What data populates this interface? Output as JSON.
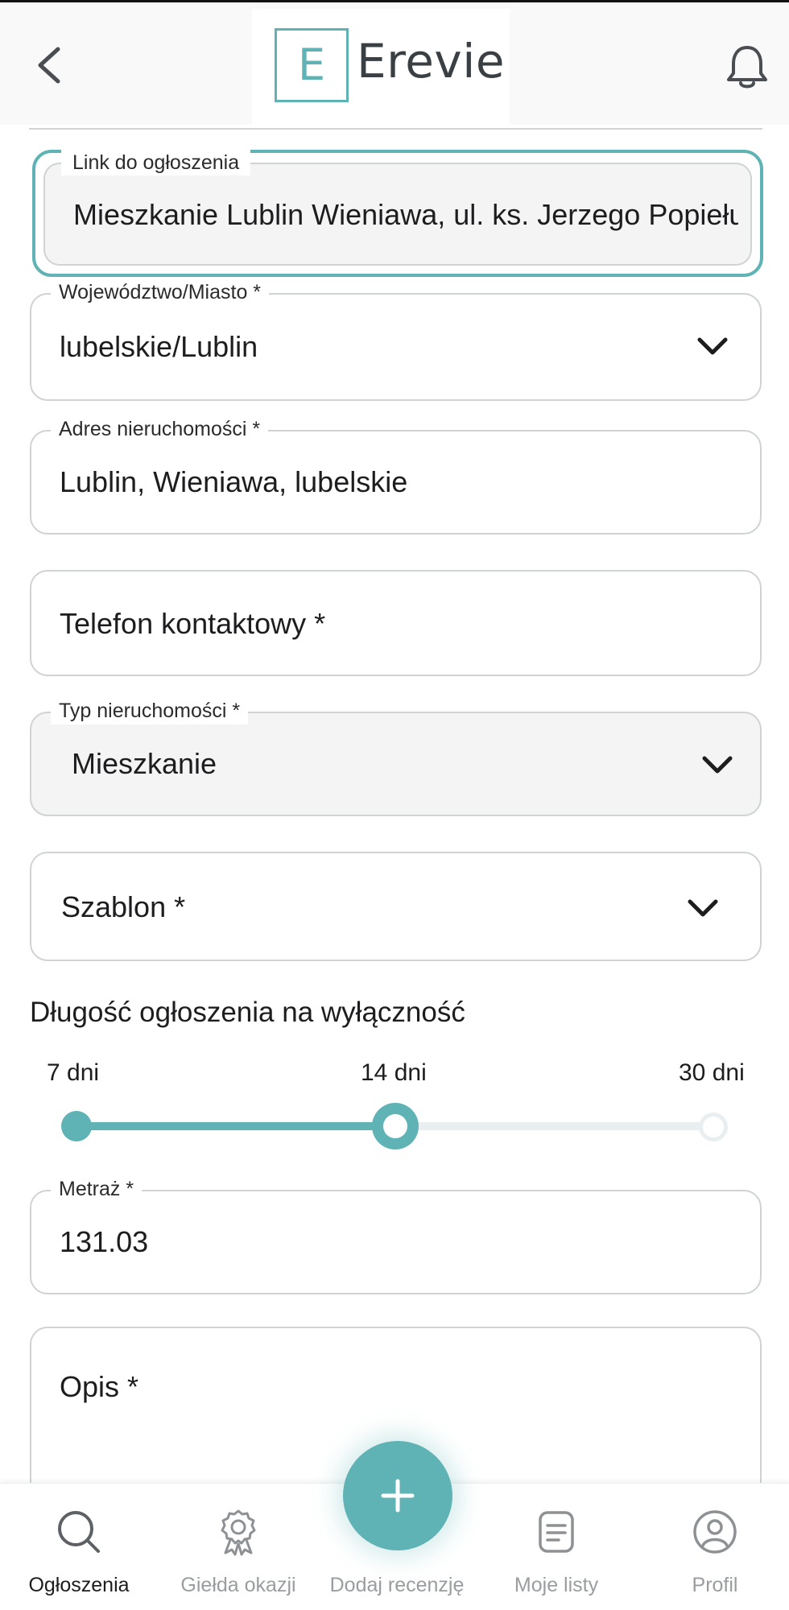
{
  "header": {
    "logo_letter": "E",
    "logo_text": "Erevie",
    "icons": {
      "back": "chevron-left-icon",
      "notifications": "bell-icon"
    }
  },
  "form": {
    "link": {
      "label": "Link do ogłoszenia",
      "value": "Mieszkanie Lublin Wieniawa, ul. ks. Jerzego Popiełuszki"
    },
    "voivodeship": {
      "label": "Województwo/Miasto *",
      "value": "lubelskie/Lublin"
    },
    "address": {
      "label": "Adres nieruchomości *",
      "value": "Lublin, Wieniawa, lubelskie"
    },
    "phone": {
      "placeholder": "Telefon kontaktowy *"
    },
    "property_type": {
      "label": "Typ nieruchomości *",
      "value": "Mieszkanie"
    },
    "template": {
      "placeholder": "Szablon *"
    },
    "exclusivity": {
      "title": "Długość ogłoszenia na wyłączność",
      "options": [
        "7 dni",
        "14 dni",
        "30 dni"
      ],
      "selected": "14 dni",
      "fill_fraction": 0.5
    },
    "area": {
      "label": "Metraż *",
      "value": "131.03"
    },
    "description": {
      "placeholder": "Opis *"
    }
  },
  "bottom_nav": {
    "items": [
      {
        "label": "Ogłoszenia",
        "icon": "search-icon",
        "active": true
      },
      {
        "label": "Giełda okazji",
        "icon": "award-icon",
        "active": false
      },
      {
        "label": "Dodaj recenzję",
        "icon": "plus-icon",
        "active": false
      },
      {
        "label": "Moje listy",
        "icon": "list-icon",
        "active": false
      },
      {
        "label": "Profil",
        "icon": "user-icon",
        "active": false
      }
    ]
  },
  "colors": {
    "accent": "#5fb3b5",
    "border": "#cfd3d2",
    "filled_bg": "#f3f4f3",
    "muted_text": "#9a9d9f"
  }
}
